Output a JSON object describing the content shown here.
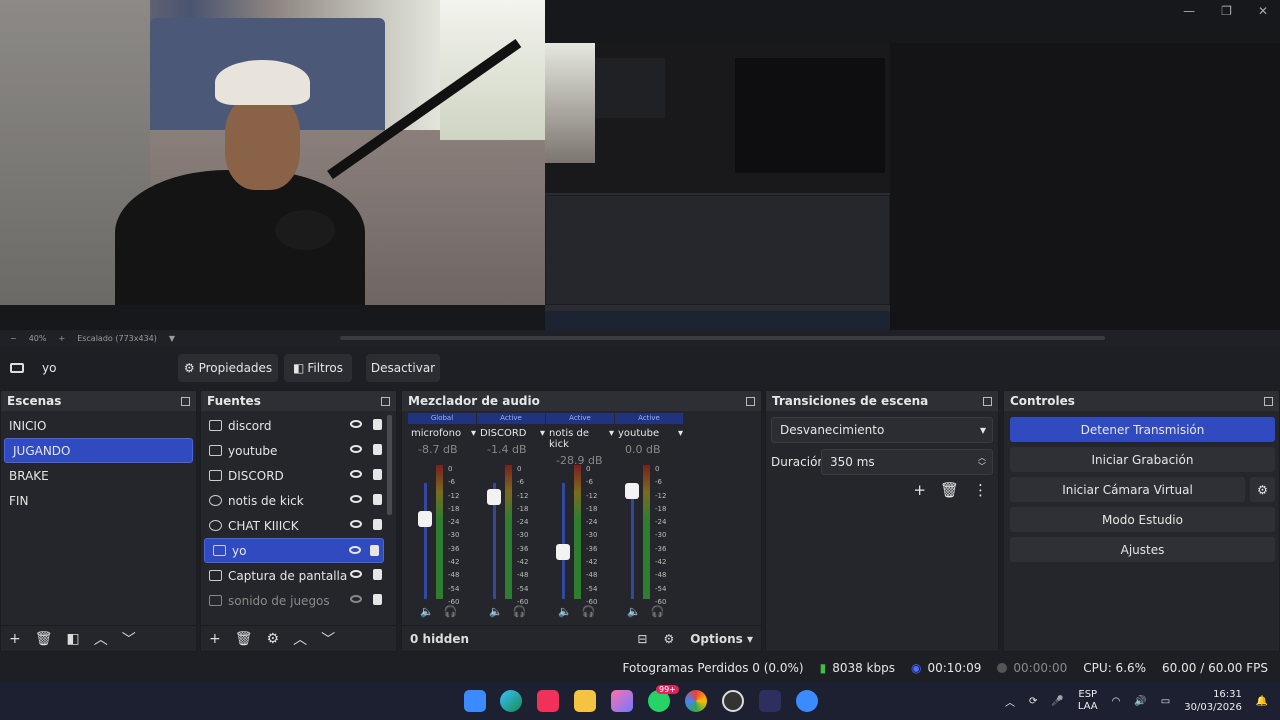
{
  "preview": {
    "zoom": "40%",
    "scale_label": "Escalado (773x434)"
  },
  "source_bar": {
    "source_name": "yo",
    "btn_properties": "Propiedades",
    "btn_filters": "Filtros",
    "btn_deactivate": "Desactivar"
  },
  "scenes": {
    "title": "Escenas",
    "items": [
      "INICIO",
      "JUGANDO",
      "BRAKE",
      "FIN"
    ],
    "selected": "JUGANDO"
  },
  "sources": {
    "title": "Fuentes",
    "items": [
      "discord",
      "youtube",
      "DISCORD",
      "notis de kick",
      "CHAT KIIICK",
      "yo",
      "Captura de pantalla",
      "sonido de juegos"
    ],
    "selected": "yo"
  },
  "mixer": {
    "title": "Mezclador de audio",
    "channels": [
      {
        "badge": "Global",
        "name": "microfono",
        "db": "-8.7 dB",
        "level": 0.75
      },
      {
        "badge": "Active",
        "name": "DISCORD",
        "db": "-1.4 dB",
        "level": 0.95
      },
      {
        "badge": "Active",
        "name": "notis de kick",
        "db": "-28.9 dB",
        "level": 0.45
      },
      {
        "badge": "Active",
        "name": "youtube",
        "db": "0.0 dB",
        "level": 1.0
      }
    ],
    "scale": [
      "0",
      "-6",
      "-12",
      "-18",
      "-24",
      "-30",
      "-36",
      "-42",
      "-48",
      "-54",
      "-60"
    ],
    "hidden_label": "0 hidden",
    "options_label": "Options"
  },
  "transitions": {
    "title": "Transiciones de escena",
    "transition": "Desvanecimiento",
    "duration_label": "Duración",
    "duration_value": "350 ms"
  },
  "controls": {
    "title": "Controles",
    "stop_stream": "Detener Transmisión",
    "start_recording": "Iniciar Grabación",
    "start_virtual_cam": "Iniciar Cámara Virtual",
    "studio_mode": "Modo Estudio",
    "settings": "Ajustes"
  },
  "status": {
    "dropped_frames": "Fotogramas Perdidos 0 (0.0%)",
    "bitrate": "8038 kbps",
    "stream_time": "00:10:09",
    "record_time": "00:00:00",
    "cpu": "CPU: 6.6%",
    "fps": "60.00 / 60.00 FPS"
  },
  "taskbar": {
    "lang": "ESP",
    "layout": "LAA",
    "time": "16:31",
    "date": "30/03/2026",
    "whatsapp_badge": "99+"
  },
  "colors": {
    "accent": "#2f4bbf",
    "panel": "#25262b",
    "header": "#2e2f35"
  }
}
